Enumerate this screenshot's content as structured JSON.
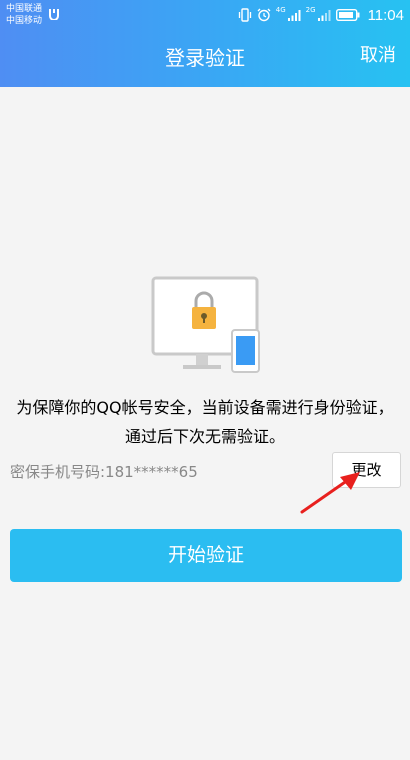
{
  "status_bar": {
    "carrier_1": "中国联通",
    "carrier_2": "中国移动",
    "network_1": "4G",
    "network_2": "2G",
    "time": "11:04",
    "icons": [
      "notification-icon",
      "vibrate-icon",
      "alarm-icon",
      "signal-icon",
      "signal-icon",
      "battery-icon"
    ]
  },
  "nav": {
    "title": "登录验证",
    "cancel_label": "取消"
  },
  "illustration": {
    "icons": [
      "monitor-icon",
      "lock-icon",
      "phone-icon"
    ]
  },
  "content": {
    "message": "为保障你的QQ帐号安全，当前设备需进行身份验证，通过后下次无需验证。",
    "phone_label": "密保手机号码:181******65",
    "change_label": "更改",
    "start_label": "开始验证"
  },
  "colors": {
    "header_gradient_start": "#4f8ef3",
    "header_gradient_end": "#27c2f2",
    "primary_button": "#2bbdf1",
    "annotation_arrow": "#e8201e",
    "lock": "#f5b33f"
  }
}
